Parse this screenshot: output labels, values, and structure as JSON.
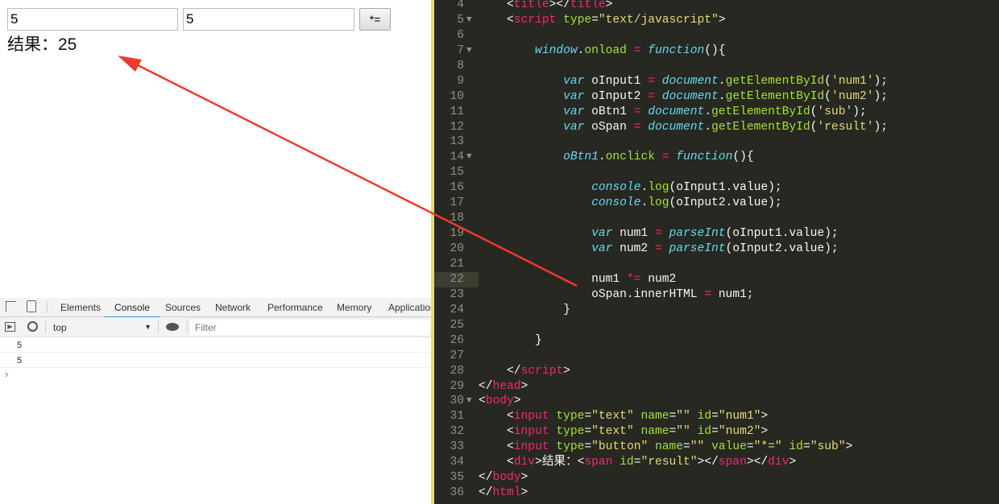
{
  "page": {
    "input1_value": "5",
    "input2_value": "5",
    "button_label": "*=",
    "result_label": "结果：",
    "result_value": "25"
  },
  "devtools": {
    "tabs": [
      "Elements",
      "Console",
      "Sources",
      "Network",
      "Performance",
      "Memory",
      "Application"
    ],
    "active_tab": "Console",
    "context": "top",
    "filter_placeholder": "Filter",
    "messages": [
      "5",
      "5"
    ],
    "prompt": "›"
  },
  "editor": {
    "current_line": 22,
    "colors": {
      "tag": "#f92672",
      "attr": "#a6e22e",
      "string": "#e6db74",
      "keyword": "#66d9ef",
      "bg": "#272822"
    },
    "lines": [
      {
        "n": 4,
        "tokens": [
          [
            "p",
            "    <"
          ],
          [
            "t",
            "title"
          ],
          [
            "p",
            "></"
          ],
          [
            "t",
            "title"
          ],
          [
            "p",
            ">"
          ]
        ]
      },
      {
        "n": 5,
        "fold": true,
        "tokens": [
          [
            "p",
            "    <"
          ],
          [
            "t",
            "script"
          ],
          [
            "p",
            " "
          ],
          [
            "a",
            "type"
          ],
          [
            "p",
            "="
          ],
          [
            "s",
            "\"text/javascript\""
          ],
          [
            "p",
            ">"
          ]
        ]
      },
      {
        "n": 6,
        "tokens": []
      },
      {
        "n": 7,
        "fold": true,
        "tokens": [
          [
            "k",
            "        window"
          ],
          [
            "p",
            "."
          ],
          [
            "f",
            "onload"
          ],
          [
            "p",
            " "
          ],
          [
            "o",
            "="
          ],
          [
            "p",
            " "
          ],
          [
            "k",
            "function"
          ],
          [
            "p",
            "(){"
          ]
        ]
      },
      {
        "n": 8,
        "tokens": []
      },
      {
        "n": 9,
        "tokens": [
          [
            "k",
            "            var"
          ],
          [
            "p",
            " oInput1 "
          ],
          [
            "o",
            "="
          ],
          [
            "p",
            " "
          ],
          [
            "k",
            "document"
          ],
          [
            "p",
            "."
          ],
          [
            "f",
            "getElementById"
          ],
          [
            "p",
            "("
          ],
          [
            "s",
            "'num1'"
          ],
          [
            "p",
            ");"
          ]
        ]
      },
      {
        "n": 10,
        "tokens": [
          [
            "k",
            "            var"
          ],
          [
            "p",
            " oInput2 "
          ],
          [
            "o",
            "="
          ],
          [
            "p",
            " "
          ],
          [
            "k",
            "document"
          ],
          [
            "p",
            "."
          ],
          [
            "f",
            "getElementById"
          ],
          [
            "p",
            "("
          ],
          [
            "s",
            "'num2'"
          ],
          [
            "p",
            ");"
          ]
        ]
      },
      {
        "n": 11,
        "tokens": [
          [
            "k",
            "            var"
          ],
          [
            "p",
            " oBtn1 "
          ],
          [
            "o",
            "="
          ],
          [
            "p",
            " "
          ],
          [
            "k",
            "document"
          ],
          [
            "p",
            "."
          ],
          [
            "f",
            "getElementById"
          ],
          [
            "p",
            "("
          ],
          [
            "s",
            "'sub'"
          ],
          [
            "p",
            ");"
          ]
        ]
      },
      {
        "n": 12,
        "tokens": [
          [
            "k",
            "            var"
          ],
          [
            "p",
            " oSpan "
          ],
          [
            "o",
            "="
          ],
          [
            "p",
            " "
          ],
          [
            "k",
            "document"
          ],
          [
            "p",
            "."
          ],
          [
            "f",
            "getElementById"
          ],
          [
            "p",
            "("
          ],
          [
            "s",
            "'result'"
          ],
          [
            "p",
            ");"
          ]
        ]
      },
      {
        "n": 13,
        "tokens": []
      },
      {
        "n": 14,
        "fold": true,
        "tokens": [
          [
            "k",
            "            oBtn1"
          ],
          [
            "p",
            "."
          ],
          [
            "f",
            "onclick"
          ],
          [
            "p",
            " "
          ],
          [
            "o",
            "="
          ],
          [
            "p",
            " "
          ],
          [
            "k",
            "function"
          ],
          [
            "p",
            "(){"
          ]
        ]
      },
      {
        "n": 15,
        "tokens": []
      },
      {
        "n": 16,
        "tokens": [
          [
            "k",
            "                console"
          ],
          [
            "p",
            "."
          ],
          [
            "f",
            "log"
          ],
          [
            "p",
            "(oInput1.value);"
          ]
        ]
      },
      {
        "n": 17,
        "tokens": [
          [
            "k",
            "                console"
          ],
          [
            "p",
            "."
          ],
          [
            "f",
            "log"
          ],
          [
            "p",
            "(oInput2.value);"
          ]
        ]
      },
      {
        "n": 18,
        "tokens": []
      },
      {
        "n": 19,
        "tokens": [
          [
            "k",
            "                var"
          ],
          [
            "p",
            " num1 "
          ],
          [
            "o",
            "="
          ],
          [
            "p",
            " "
          ],
          [
            "k",
            "parseInt"
          ],
          [
            "p",
            "(oInput1.value);"
          ]
        ]
      },
      {
        "n": 20,
        "tokens": [
          [
            "k",
            "                var"
          ],
          [
            "p",
            " num2 "
          ],
          [
            "o",
            "="
          ],
          [
            "p",
            " "
          ],
          [
            "k",
            "parseInt"
          ],
          [
            "p",
            "(oInput2.value);"
          ]
        ]
      },
      {
        "n": 21,
        "tokens": []
      },
      {
        "n": 22,
        "tokens": [
          [
            "p",
            "                num1 "
          ],
          [
            "o",
            "*="
          ],
          [
            "p",
            " num2"
          ]
        ]
      },
      {
        "n": 23,
        "tokens": [
          [
            "p",
            "                oSpan.innerHTML "
          ],
          [
            "o",
            "="
          ],
          [
            "p",
            " num1;"
          ]
        ]
      },
      {
        "n": 24,
        "tokens": [
          [
            "p",
            "            }"
          ]
        ]
      },
      {
        "n": 25,
        "tokens": []
      },
      {
        "n": 26,
        "tokens": [
          [
            "p",
            "        }"
          ]
        ]
      },
      {
        "n": 27,
        "tokens": []
      },
      {
        "n": 28,
        "tokens": [
          [
            "p",
            "    </"
          ],
          [
            "t",
            "script"
          ],
          [
            "p",
            ">"
          ]
        ]
      },
      {
        "n": 29,
        "tokens": [
          [
            "p",
            "</"
          ],
          [
            "t",
            "head"
          ],
          [
            "p",
            ">"
          ]
        ]
      },
      {
        "n": 30,
        "fold": true,
        "tokens": [
          [
            "p",
            "<"
          ],
          [
            "t",
            "body"
          ],
          [
            "p",
            ">"
          ]
        ]
      },
      {
        "n": 31,
        "tokens": [
          [
            "p",
            "    <"
          ],
          [
            "t",
            "input"
          ],
          [
            "p",
            " "
          ],
          [
            "a",
            "type"
          ],
          [
            "p",
            "="
          ],
          [
            "s",
            "\"text\""
          ],
          [
            "p",
            " "
          ],
          [
            "a",
            "name"
          ],
          [
            "p",
            "="
          ],
          [
            "s",
            "\"\""
          ],
          [
            "p",
            " "
          ],
          [
            "a",
            "id"
          ],
          [
            "p",
            "="
          ],
          [
            "s",
            "\"num1\""
          ],
          [
            "p",
            ">"
          ]
        ]
      },
      {
        "n": 32,
        "tokens": [
          [
            "p",
            "    <"
          ],
          [
            "t",
            "input"
          ],
          [
            "p",
            " "
          ],
          [
            "a",
            "type"
          ],
          [
            "p",
            "="
          ],
          [
            "s",
            "\"text\""
          ],
          [
            "p",
            " "
          ],
          [
            "a",
            "name"
          ],
          [
            "p",
            "="
          ],
          [
            "s",
            "\"\""
          ],
          [
            "p",
            " "
          ],
          [
            "a",
            "id"
          ],
          [
            "p",
            "="
          ],
          [
            "s",
            "\"num2\""
          ],
          [
            "p",
            ">"
          ]
        ]
      },
      {
        "n": 33,
        "tokens": [
          [
            "p",
            "    <"
          ],
          [
            "t",
            "input"
          ],
          [
            "p",
            " "
          ],
          [
            "a",
            "type"
          ],
          [
            "p",
            "="
          ],
          [
            "s",
            "\"button\""
          ],
          [
            "p",
            " "
          ],
          [
            "a",
            "name"
          ],
          [
            "p",
            "="
          ],
          [
            "s",
            "\"\""
          ],
          [
            "p",
            " "
          ],
          [
            "a",
            "value"
          ],
          [
            "p",
            "="
          ],
          [
            "s",
            "\"*=\""
          ],
          [
            "p",
            " "
          ],
          [
            "a",
            "id"
          ],
          [
            "p",
            "="
          ],
          [
            "s",
            "\"sub\""
          ],
          [
            "p",
            ">"
          ]
        ]
      },
      {
        "n": 34,
        "tokens": [
          [
            "p",
            "    <"
          ],
          [
            "t",
            "div"
          ],
          [
            "p",
            ">结果：<"
          ],
          [
            "t",
            "span"
          ],
          [
            "p",
            " "
          ],
          [
            "a",
            "id"
          ],
          [
            "p",
            "="
          ],
          [
            "s",
            "\"result\""
          ],
          [
            "p",
            "></"
          ],
          [
            "t",
            "span"
          ],
          [
            "p",
            "></"
          ],
          [
            "t",
            "div"
          ],
          [
            "p",
            ">"
          ]
        ]
      },
      {
        "n": 35,
        "tokens": [
          [
            "p",
            "</"
          ],
          [
            "t",
            "body"
          ],
          [
            "p",
            ">"
          ]
        ]
      },
      {
        "n": 36,
        "tokens": [
          [
            "p",
            "</"
          ],
          [
            "t",
            "html"
          ],
          [
            "p",
            ">"
          ]
        ]
      }
    ]
  }
}
